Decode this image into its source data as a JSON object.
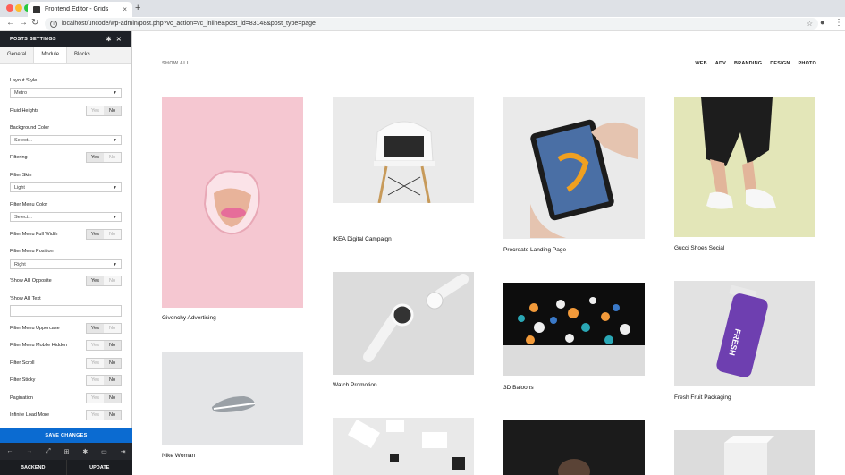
{
  "browser": {
    "tab_title": "Frontend Editor - Grids",
    "tab_close": "×",
    "new_tab": "+",
    "url": "localhost/uncode/wp-admin/post.php?vc_action=vc_inline&post_id=83148&post_type=page"
  },
  "panel": {
    "title": "POSTS SETTINGS",
    "tabs": [
      "General",
      "Module",
      "Blocks",
      "..."
    ],
    "fields": {
      "layout_style": {
        "label": "Layout Style",
        "value": "Metro"
      },
      "fluid_heights": {
        "label": "Fluid Heights",
        "yes": "Yes",
        "no": "No"
      },
      "background_color": {
        "label": "Background Color",
        "value": "Select..."
      },
      "filtering": {
        "label": "Filtering",
        "yes": "Yes",
        "no": "No"
      },
      "filter_skin": {
        "label": "Filter Skin",
        "value": "Light"
      },
      "filter_menu_color": {
        "label": "Filter Menu Color",
        "value": "Select..."
      },
      "filter_menu_full_width": {
        "label": "Filter Menu Full Width",
        "yes": "Yes",
        "no": "No"
      },
      "filter_menu_position": {
        "label": "Filter Menu Position",
        "value": "Right"
      },
      "show_all_opposite": {
        "label": "'Show All' Opposite",
        "yes": "Yes",
        "no": "No"
      },
      "show_all_text": {
        "label": "'Show All' Text",
        "value": ""
      },
      "filter_menu_uppercase": {
        "label": "Filter Menu Uppercase",
        "yes": "Yes",
        "no": "No"
      },
      "filter_menu_mobile_hidden": {
        "label": "Filter Menu Mobile Hidden",
        "yes": "Yes",
        "no": "No"
      },
      "filter_scroll": {
        "label": "Filter Scroll",
        "yes": "Yes",
        "no": "No"
      },
      "filter_sticky": {
        "label": "Filter Sticky",
        "yes": "Yes",
        "no": "No"
      },
      "pagination": {
        "label": "Pagination",
        "yes": "Yes",
        "no": "No"
      },
      "infinite_load_more": {
        "label": "Infinite Load More",
        "yes": "Yes",
        "no": "No"
      }
    },
    "save_label": "SAVE CHANGES",
    "backend_label": "BACKEND",
    "update_label": "UPDATE"
  },
  "grid": {
    "show_all": "SHOW ALL",
    "filters": [
      "WEB",
      "ADV",
      "BRANDING",
      "DESIGN",
      "PHOTO"
    ],
    "items": [
      "Givenchy Advertising",
      "IKEA Digital Campaign",
      "Procreate Landing Page",
      "Gucci Shoes Social",
      "Nike Woman",
      "Watch Promotion",
      "3D Baloons",
      "Fresh Fruit Packaging"
    ]
  },
  "colors": {
    "save_button": "#0b6bd1",
    "panel_header": "#1e2127"
  }
}
